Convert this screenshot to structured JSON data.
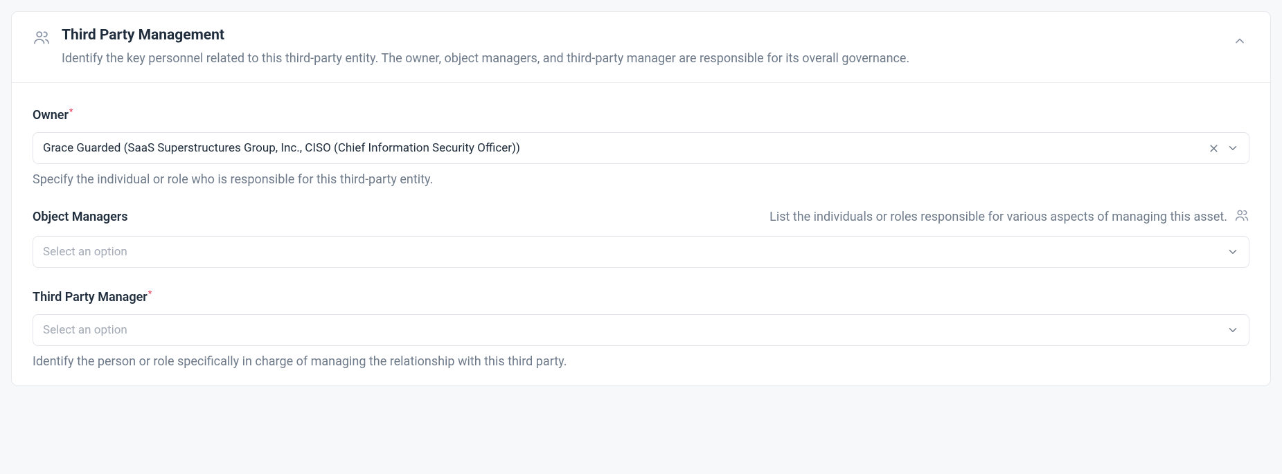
{
  "card": {
    "title": "Third Party Management",
    "subtitle": "Identify the key personnel related to this third-party entity. The owner, object managers, and third-party manager are responsible for its overall governance."
  },
  "fields": {
    "owner": {
      "label": "Owner",
      "required_mark": "*",
      "value": "Grace Guarded (SaaS Superstructures Group, Inc., CISO (Chief Information Security Officer))",
      "help": "Specify the individual or role who is responsible for this third-party entity."
    },
    "object_managers": {
      "label": "Object Managers",
      "inline_help": "List the individuals or roles responsible for various aspects of managing this asset.",
      "placeholder": "Select an option"
    },
    "third_party_manager": {
      "label": "Third Party Manager",
      "required_mark": "*",
      "placeholder": "Select an option",
      "help": "Identify the person or role specifically in charge of managing the relationship with this third party."
    }
  }
}
